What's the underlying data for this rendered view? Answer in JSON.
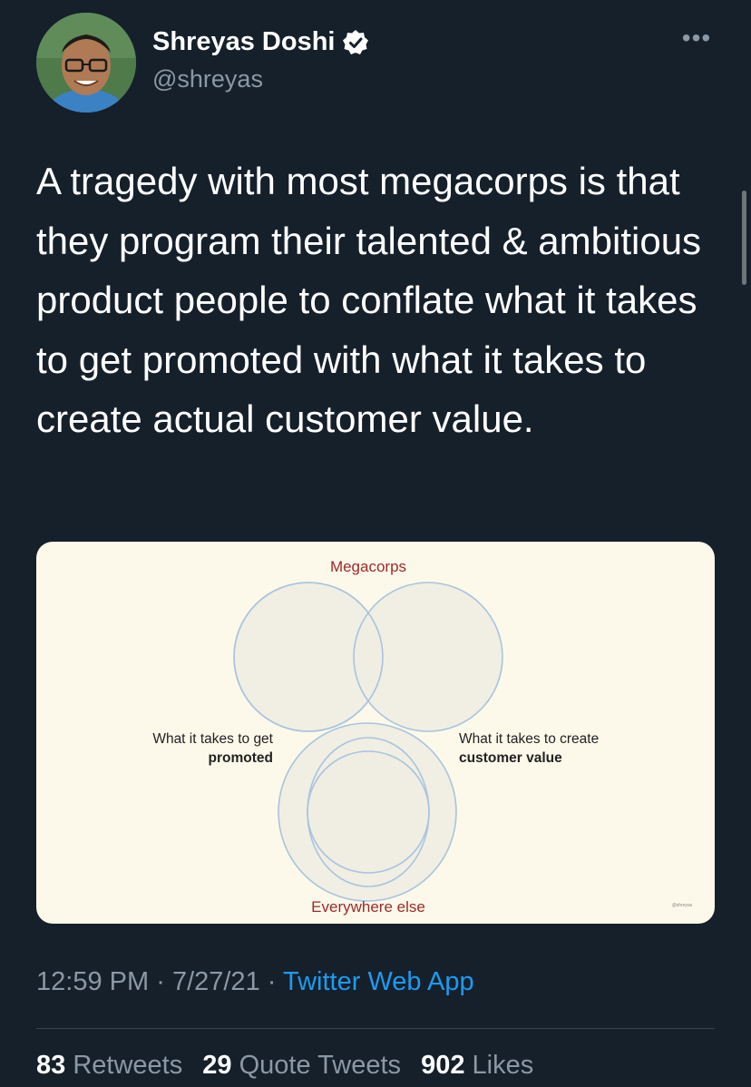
{
  "author": {
    "name": "Shreyas Doshi",
    "handle": "@shreyas",
    "verified": true,
    "verified_icon": "verified-badge-icon"
  },
  "more_label": "•••",
  "tweet": {
    "text": "A tragedy with most megacorps is that they program their talented & ambitious product people to conflate what it takes to get promoted with what it takes to create actual customer value."
  },
  "image": {
    "top_label": "Megacorps",
    "bottom_label": "Everywhere else",
    "left_label_line1": "What it takes to get",
    "left_label_line2": "promoted",
    "right_label_line1": "What it takes to create",
    "right_label_line2": "customer value",
    "watermark": "@shreyas"
  },
  "meta": {
    "time": "12:59 PM",
    "separator": "·",
    "date": "7/27/21",
    "app": "Twitter Web App"
  },
  "stats": {
    "retweets_count": "83",
    "retweets_label": "Retweets",
    "quotes_count": "29",
    "quotes_label": "Quote Tweets",
    "likes_count": "902",
    "likes_label": "Likes"
  },
  "colors": {
    "background": "#15202b",
    "text": "#ffffff",
    "secondary": "#8b98a5",
    "link": "#1d9bf0",
    "card_background": "#fdf9ea",
    "diagram_label_red": "#9b2a2a",
    "circle_stroke": "#a8c4de"
  }
}
